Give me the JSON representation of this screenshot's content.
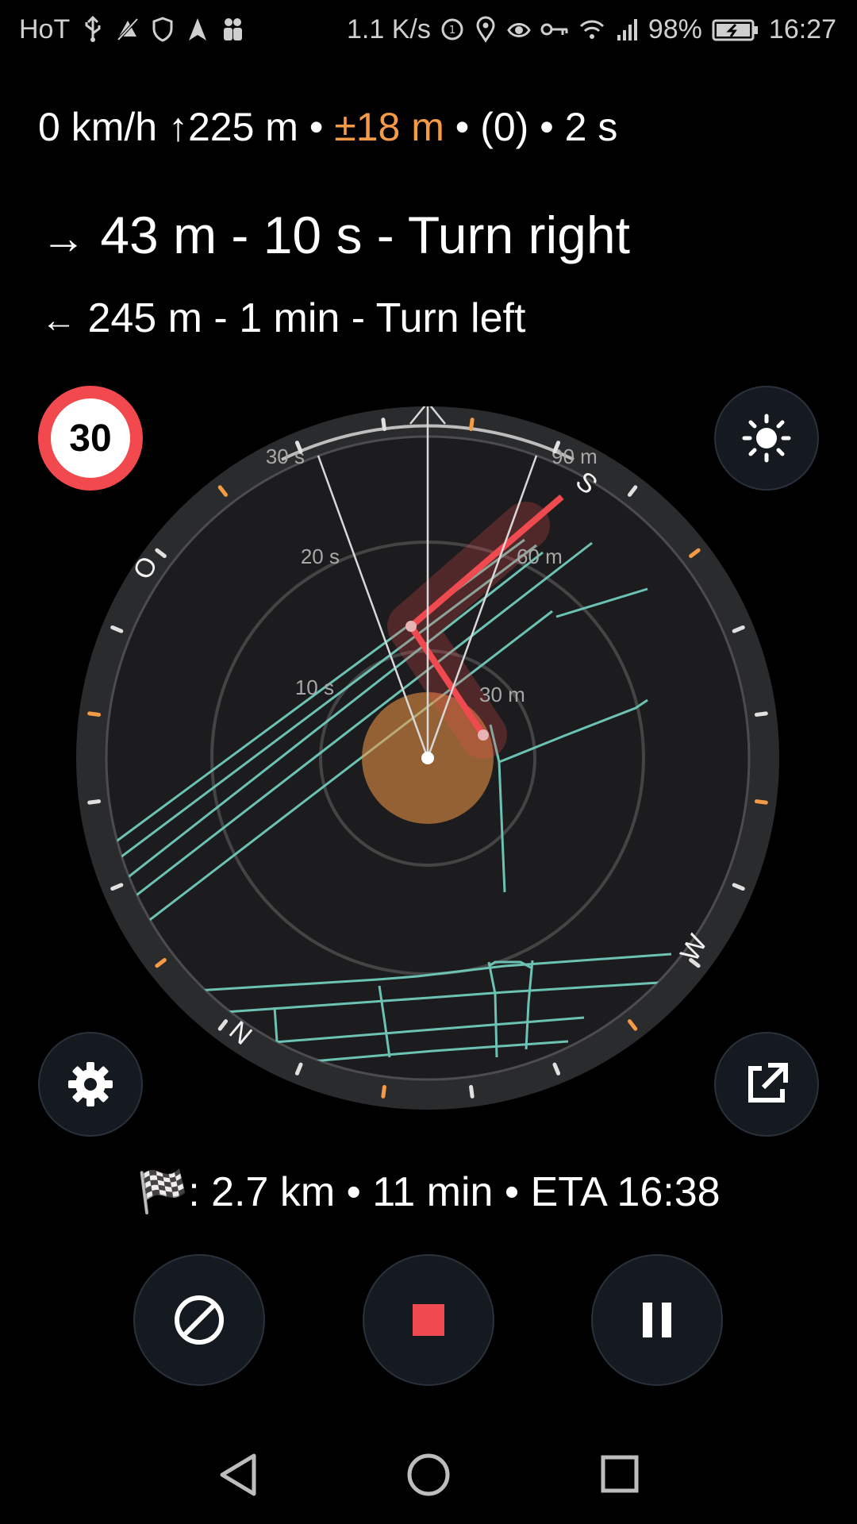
{
  "status_bar": {
    "carrier": "HoT",
    "left_icons": [
      "usb-icon",
      "no-location-icon",
      "shield-icon",
      "navigation-arrow-icon",
      "people-icon"
    ],
    "network_speed": "1.1 K/s",
    "right_icons": [
      "data-saver-icon",
      "location-pin-icon",
      "eye-icon",
      "key-icon",
      "wifi-icon",
      "cell-signal-icon"
    ],
    "battery": "98%",
    "time": "16:27"
  },
  "gps": {
    "speed": "0 km/h",
    "altitude": "↑225 m",
    "accuracy": "±18 m",
    "satellites": "(0)",
    "age": "2 s",
    "separator": "•"
  },
  "instructions": {
    "next": {
      "arrow": "→",
      "text": "43 m - 10 s - Turn right"
    },
    "following": {
      "arrow": "←",
      "text": "245 m - 1 min - Turn left"
    }
  },
  "speed_limit": {
    "value": "30"
  },
  "radar": {
    "time_labels": [
      "10 s",
      "20 s",
      "30 s"
    ],
    "distance_labels": [
      "30 m",
      "60 m",
      "90 m"
    ],
    "compass": {
      "N": "N",
      "O": "O",
      "S": "S",
      "W": "W"
    }
  },
  "summary": {
    "flag": "🏁",
    "text": ": 2.7 km • 11 min • ETA 16:38"
  },
  "buttons": {
    "brightness": "sun-icon",
    "settings": "gear-icon",
    "external": "external-link-icon",
    "cancel": "cancel-icon",
    "stop": "stop-icon",
    "pause": "pause-icon"
  },
  "colors": {
    "accent_orange": "#f59a45",
    "route_red": "#ef4a4f",
    "street_teal": "#6cc2b3",
    "ring_dark": "#232426",
    "speed_limit_red": "#f2494f"
  }
}
